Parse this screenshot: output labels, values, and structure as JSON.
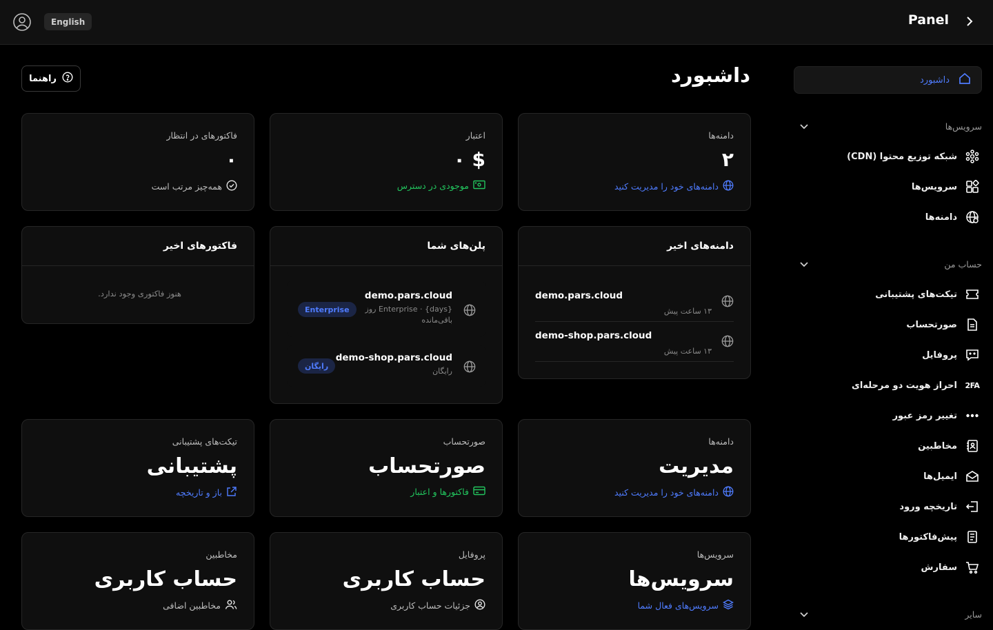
{
  "topbar": {
    "lang": "English",
    "brand": "Panel"
  },
  "sidebar": {
    "active": "داشبورد",
    "sections": [
      {
        "label": "سرویس‌ها"
      },
      {
        "label": "حساب من"
      },
      {
        "label": "سایر"
      }
    ],
    "services": [
      {
        "label": "شبکه توزیع محتوا (CDN)",
        "icon": "cdn-icon"
      },
      {
        "label": "سرویس‌ها",
        "icon": "apps-icon"
      },
      {
        "label": "دامنه‌ها",
        "icon": "globe-icon"
      }
    ],
    "account": [
      {
        "label": "تیکت‌های پشتیبانی",
        "icon": "ticket-icon"
      },
      {
        "label": "صورتحساب",
        "icon": "invoice-icon"
      },
      {
        "label": "پروفایل",
        "icon": "profile-icon"
      },
      {
        "label": "احراز هویت دو مرحله‌ای",
        "icon": "2fa-icon",
        "glyph": "2FA"
      },
      {
        "label": "تغییر رمز عبور",
        "icon": "password-icon"
      },
      {
        "label": "مخاطبین",
        "icon": "contacts-icon"
      },
      {
        "label": "ایمیل‌ها",
        "icon": "email-icon"
      },
      {
        "label": "تاریخچه ورود",
        "icon": "login-history-icon"
      },
      {
        "label": "پیش‌فاکتورها",
        "icon": "proforma-icon"
      },
      {
        "label": "سفارش",
        "icon": "cart-icon"
      }
    ]
  },
  "main": {
    "title": "داشبورد",
    "help_label": "راهنما",
    "stats": [
      {
        "label": "دامنه‌ها",
        "value": "۲",
        "link": "دامنه‌های خود را مدیریت کنید",
        "color": "#4f7cff"
      },
      {
        "label": "اعتبار",
        "value": "$ ۰",
        "link": "موجودی در دسترس",
        "color": "#22c55e"
      },
      {
        "label": "فاکتورهای در انتظار",
        "value": "۰",
        "link": "همه‌چیز مرتب است",
        "color": "#bdbdbd"
      }
    ],
    "recent_domains": {
      "title": "دامنه‌های اخیر",
      "items": [
        {
          "name": "demo.pars.cloud",
          "time": "۱۳ ساعت پیش"
        },
        {
          "name": "demo-shop.pars.cloud",
          "time": "۱۳ ساعت پیش"
        }
      ]
    },
    "plans": {
      "title": "پلن‌های شما",
      "items": [
        {
          "name": "demo.pars.cloud",
          "sub": "Enterprise · {days} روز باقی‌مانده",
          "badge": "Enterprise"
        },
        {
          "name": "demo-shop.pars.cloud",
          "sub": "رایگان",
          "badge": "رایگان"
        }
      ]
    },
    "recent_invoices": {
      "title": "فاکتورهای اخیر",
      "empty": "هنوز فاکتوری وجود ندارد."
    },
    "quick": [
      {
        "label": "دامنه‌ها",
        "value": "مدیریت",
        "link": "دامنه‌های خود را مدیریت کنید",
        "color": "#4f7cff"
      },
      {
        "label": "صورتحساب",
        "value": "صورتحساب",
        "link": "فاکتورها و اعتبار",
        "color": "#22c55e"
      },
      {
        "label": "تیکت‌های پشتیبانی",
        "value": "پشتیبانی",
        "link": "باز و تاریخچه",
        "color": "#4f7cff"
      },
      {
        "label": "سرویس‌ها",
        "value": "سرویس‌ها",
        "link": "سرویس‌های فعال شما",
        "color": "#4f7cff"
      },
      {
        "label": "پروفایل",
        "value": "حساب کاربری",
        "link": "جزئیات حساب کاربری",
        "color": "#bdbdbd"
      },
      {
        "label": "مخاطبین",
        "value": "حساب کاربری",
        "link": "مخاطبین اضافی",
        "color": "#bdbdbd"
      }
    ]
  }
}
